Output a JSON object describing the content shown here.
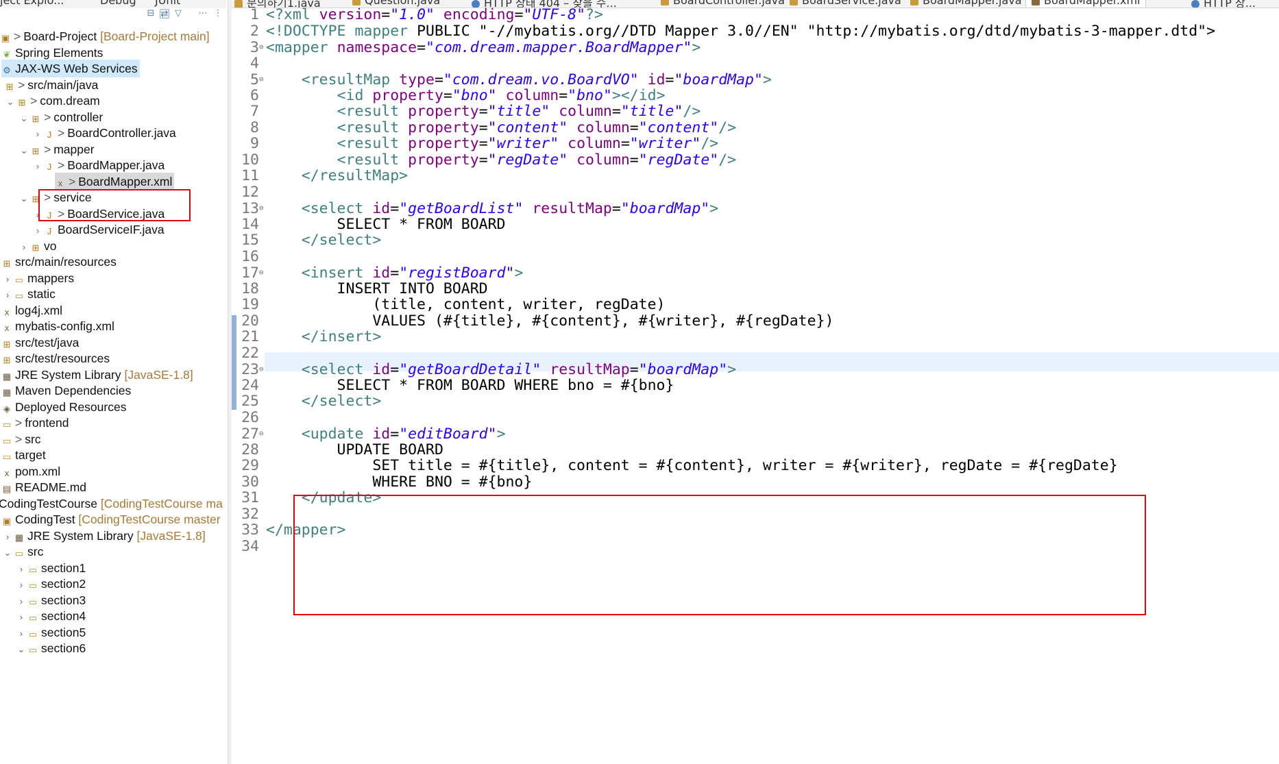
{
  "left_tabs": [
    "ject Explo...",
    "Debug",
    "JUnit"
  ],
  "left_toolbar_icons": [
    "collapse-all-icon",
    "link-with-editor-icon",
    "filter-icon",
    "view-menu-icon",
    "more-icon"
  ],
  "editor_tabs": [
    {
      "label": "문의하기1.java",
      "active": false
    },
    {
      "label": "Question.java",
      "active": false
    },
    {
      "label": "HTTP 상태 404 – 찾을 수...",
      "active": false
    },
    {
      "label": "BoardController.java",
      "active": false
    },
    {
      "label": "BoardService.java",
      "active": false
    },
    {
      "label": "BoardMapper.java",
      "active": false
    },
    {
      "label": "BoardMapper.xml",
      "active": true
    },
    {
      "label": "HTTP 상...",
      "active": false
    }
  ],
  "tree": [
    {
      "text": "Board-Project",
      "dim": "[Board-Project main]",
      "prefix": ">",
      "icon": "project-icon",
      "state": "none"
    },
    {
      "text": "Spring Elements",
      "icon": "spring-icon",
      "state": "none"
    },
    {
      "text": "JAX-WS Web Services",
      "icon": "webservice-icon",
      "state": "highlight"
    },
    {
      "text": "src/main/java",
      "prefix": ">",
      "icon": "source-folder-icon",
      "state": "none"
    },
    {
      "text": "com.dream",
      "prefix": ">",
      "icon": "package-icon",
      "chevron": "⌄",
      "state": "none"
    },
    {
      "text": "controller",
      "prefix": ">",
      "icon": "package-icon",
      "chevron": "⌄",
      "state": "none"
    },
    {
      "text": "BoardController.java",
      "prefix": ">",
      "icon": "java-file-icon",
      "chevron": "›",
      "state": "none"
    },
    {
      "text": "mapper",
      "prefix": ">",
      "icon": "package-icon",
      "chevron": "⌄",
      "state": "none"
    },
    {
      "text": "BoardMapper.java",
      "prefix": ">",
      "icon": "java-file-icon",
      "chevron": "›",
      "state": "none"
    },
    {
      "text": "BoardMapper.xml",
      "prefix": ">",
      "icon": "xml-file-icon",
      "state": "selected"
    },
    {
      "text": "service",
      "prefix": ">",
      "icon": "package-icon",
      "chevron": "⌄",
      "state": "none"
    },
    {
      "text": "BoardService.java",
      "prefix": ">",
      "icon": "java-file-icon",
      "chevron": "›",
      "state": "none"
    },
    {
      "text": "BoardServiceIF.java",
      "icon": "java-file-icon",
      "chevron": "›",
      "state": "none"
    },
    {
      "text": "vo",
      "icon": "package-icon",
      "chevron": "›",
      "state": "none"
    },
    {
      "text": "src/main/resources",
      "icon": "source-folder-icon",
      "state": "none"
    },
    {
      "text": "mappers",
      "icon": "folder-icon",
      "chevron": "›",
      "state": "none"
    },
    {
      "text": "static",
      "icon": "folder-icon",
      "chevron": "›",
      "state": "none"
    },
    {
      "text": "log4j.xml",
      "icon": "xml-file-icon",
      "state": "none"
    },
    {
      "text": "mybatis-config.xml",
      "icon": "xml-file-icon",
      "state": "none"
    },
    {
      "text": "src/test/java",
      "icon": "source-folder-icon",
      "state": "none"
    },
    {
      "text": "src/test/resources",
      "icon": "source-folder-icon",
      "state": "none"
    },
    {
      "text": "JRE System Library",
      "dim": "[JavaSE-1.8]",
      "icon": "library-icon",
      "state": "none"
    },
    {
      "text": "Maven Dependencies",
      "icon": "library-icon",
      "state": "none"
    },
    {
      "text": "Deployed Resources",
      "icon": "deployed-icon",
      "state": "none"
    },
    {
      "text": "frontend",
      "prefix": ">",
      "icon": "folder-icon",
      "state": "none"
    },
    {
      "text": "src",
      "prefix": ">",
      "icon": "folder-icon",
      "state": "none"
    },
    {
      "text": "target",
      "icon": "folder-icon",
      "state": "none"
    },
    {
      "text": "pom.xml",
      "icon": "xml-file-icon",
      "state": "none"
    },
    {
      "text": "README.md",
      "icon": "file-icon",
      "state": "none"
    },
    {
      "text": "CodingTestCourse",
      "dim": "[CodingTestCourse ma",
      "icon": "none",
      "state": "none"
    },
    {
      "text": "CodingTest",
      "dim": "[CodingTestCourse master",
      "icon": "project-icon",
      "state": "none"
    },
    {
      "text": "JRE System Library",
      "dim": "[JavaSE-1.8]",
      "icon": "library-icon",
      "chevron": "›",
      "state": "none"
    },
    {
      "text": "src",
      "icon": "folder-icon",
      "chevron": "⌄",
      "state": "none"
    },
    {
      "text": "section1",
      "icon": "folder-icon",
      "chevron": "›",
      "state": "none"
    },
    {
      "text": "section2",
      "icon": "folder-icon",
      "chevron": "›",
      "state": "none"
    },
    {
      "text": "section3",
      "icon": "folder-icon",
      "chevron": "›",
      "state": "none"
    },
    {
      "text": "section4",
      "icon": "folder-icon",
      "chevron": "›",
      "state": "none"
    },
    {
      "text": "section5",
      "icon": "folder-icon",
      "chevron": "›",
      "state": "none"
    },
    {
      "text": "section6",
      "icon": "folder-icon",
      "chevron": "⌄",
      "state": "none"
    }
  ],
  "code": [
    {
      "n": "1",
      "fold": false,
      "parts": [
        [
          "pi",
          "<?xml "
        ],
        [
          "attr",
          "version"
        ],
        [
          "txt",
          "="
        ],
        [
          "val",
          "\"1.0\""
        ],
        [
          "txt",
          " "
        ],
        [
          "attr",
          "encoding"
        ],
        [
          "txt",
          "="
        ],
        [
          "val",
          "\"UTF-8\""
        ],
        [
          "pi",
          "?>"
        ]
      ]
    },
    {
      "n": "2",
      "fold": false,
      "parts": [
        [
          "tag",
          "<!DOCTYPE "
        ],
        [
          "tag",
          "mapper"
        ],
        [
          "txt",
          " PUBLIC \"-//mybatis.org//DTD Mapper 3.0//EN\" \"http://mybatis.org/dtd/mybatis-3-mapper.dtd\">"
        ]
      ]
    },
    {
      "n": "3",
      "fold": true,
      "parts": [
        [
          "tag",
          "<mapper "
        ],
        [
          "attr",
          "namespace"
        ],
        [
          "txt",
          "="
        ],
        [
          "val",
          "\"com.dream.mapper.BoardMapper\""
        ],
        [
          "tag",
          ">"
        ]
      ]
    },
    {
      "n": "4",
      "fold": false,
      "parts": []
    },
    {
      "n": "5",
      "fold": true,
      "parts": [
        [
          "txt",
          "    "
        ],
        [
          "tag",
          "<resultMap "
        ],
        [
          "attr",
          "type"
        ],
        [
          "txt",
          "="
        ],
        [
          "val",
          "\"com.dream.vo.BoardVO\""
        ],
        [
          "txt",
          " "
        ],
        [
          "attr",
          "id"
        ],
        [
          "txt",
          "="
        ],
        [
          "val",
          "\"boardMap\""
        ],
        [
          "tag",
          ">"
        ]
      ]
    },
    {
      "n": "6",
      "fold": false,
      "parts": [
        [
          "txt",
          "        "
        ],
        [
          "tag",
          "<id "
        ],
        [
          "attr",
          "property"
        ],
        [
          "txt",
          "="
        ],
        [
          "val",
          "\"bno\""
        ],
        [
          "txt",
          " "
        ],
        [
          "attr",
          "column"
        ],
        [
          "txt",
          "="
        ],
        [
          "val",
          "\"bno\""
        ],
        [
          "tag",
          "></id>"
        ]
      ]
    },
    {
      "n": "7",
      "fold": false,
      "parts": [
        [
          "txt",
          "        "
        ],
        [
          "tag",
          "<result "
        ],
        [
          "attr",
          "property"
        ],
        [
          "txt",
          "="
        ],
        [
          "val",
          "\"title\""
        ],
        [
          "txt",
          " "
        ],
        [
          "attr",
          "column"
        ],
        [
          "txt",
          "="
        ],
        [
          "val",
          "\"title\""
        ],
        [
          "tag",
          "/>"
        ]
      ]
    },
    {
      "n": "8",
      "fold": false,
      "parts": [
        [
          "txt",
          "        "
        ],
        [
          "tag",
          "<result "
        ],
        [
          "attr",
          "property"
        ],
        [
          "txt",
          "="
        ],
        [
          "val",
          "\"content\""
        ],
        [
          "txt",
          " "
        ],
        [
          "attr",
          "column"
        ],
        [
          "txt",
          "="
        ],
        [
          "val",
          "\"content\""
        ],
        [
          "tag",
          "/>"
        ]
      ]
    },
    {
      "n": "9",
      "fold": false,
      "parts": [
        [
          "txt",
          "        "
        ],
        [
          "tag",
          "<result "
        ],
        [
          "attr",
          "property"
        ],
        [
          "txt",
          "="
        ],
        [
          "val",
          "\"writer\""
        ],
        [
          "txt",
          " "
        ],
        [
          "attr",
          "column"
        ],
        [
          "txt",
          "="
        ],
        [
          "val",
          "\"writer\""
        ],
        [
          "tag",
          "/>"
        ]
      ]
    },
    {
      "n": "10",
      "fold": false,
      "parts": [
        [
          "txt",
          "        "
        ],
        [
          "tag",
          "<result "
        ],
        [
          "attr",
          "property"
        ],
        [
          "txt",
          "="
        ],
        [
          "val",
          "\"regDate\""
        ],
        [
          "txt",
          " "
        ],
        [
          "attr",
          "column"
        ],
        [
          "txt",
          "="
        ],
        [
          "val",
          "\"regDate\""
        ],
        [
          "tag",
          "/>"
        ]
      ]
    },
    {
      "n": "11",
      "fold": false,
      "parts": [
        [
          "txt",
          "    "
        ],
        [
          "tag",
          "</resultMap>"
        ]
      ]
    },
    {
      "n": "12",
      "fold": false,
      "parts": []
    },
    {
      "n": "13",
      "fold": true,
      "parts": [
        [
          "txt",
          "    "
        ],
        [
          "tag",
          "<select "
        ],
        [
          "attr",
          "id"
        ],
        [
          "txt",
          "="
        ],
        [
          "val",
          "\"getBoardList\""
        ],
        [
          "txt",
          " "
        ],
        [
          "attr",
          "resultMap"
        ],
        [
          "txt",
          "="
        ],
        [
          "val",
          "\"boardMap\""
        ],
        [
          "tag",
          ">"
        ]
      ]
    },
    {
      "n": "14",
      "fold": false,
      "parts": [
        [
          "txt",
          "        SELECT * FROM BOARD"
        ]
      ]
    },
    {
      "n": "15",
      "fold": false,
      "parts": [
        [
          "txt",
          "    "
        ],
        [
          "tag",
          "</select>"
        ]
      ]
    },
    {
      "n": "16",
      "fold": false,
      "parts": []
    },
    {
      "n": "17",
      "fold": true,
      "parts": [
        [
          "txt",
          "    "
        ],
        [
          "tag",
          "<insert "
        ],
        [
          "attr",
          "id"
        ],
        [
          "txt",
          "="
        ],
        [
          "val",
          "\"registBoard\""
        ],
        [
          "tag",
          ">"
        ]
      ]
    },
    {
      "n": "18",
      "fold": false,
      "parts": [
        [
          "txt",
          "        INSERT INTO BOARD"
        ]
      ]
    },
    {
      "n": "19",
      "fold": false,
      "parts": [
        [
          "txt",
          "            (title, content, writer, regDate)"
        ]
      ]
    },
    {
      "n": "20",
      "fold": false,
      "parts": [
        [
          "txt",
          "            VALUES (#{title}, #{content}, #{writer}, #{regDate})"
        ]
      ]
    },
    {
      "n": "21",
      "fold": false,
      "parts": [
        [
          "txt",
          "    "
        ],
        [
          "tag",
          "</insert>"
        ]
      ]
    },
    {
      "n": "22",
      "fold": false,
      "parts": []
    },
    {
      "n": "23",
      "fold": true,
      "parts": [
        [
          "txt",
          "    "
        ],
        [
          "tag",
          "<select "
        ],
        [
          "attr",
          "id"
        ],
        [
          "txt",
          "="
        ],
        [
          "val",
          "\"getBoardDetail\""
        ],
        [
          "txt",
          " "
        ],
        [
          "attr",
          "resultMap"
        ],
        [
          "txt",
          "="
        ],
        [
          "val",
          "\"boardMap\""
        ],
        [
          "tag",
          ">"
        ]
      ]
    },
    {
      "n": "24",
      "fold": false,
      "parts": [
        [
          "txt",
          "        SELECT * FROM BOARD WHERE bno = #{bno}"
        ]
      ]
    },
    {
      "n": "25",
      "fold": false,
      "parts": [
        [
          "txt",
          "    "
        ],
        [
          "tag",
          "</select>"
        ]
      ]
    },
    {
      "n": "26",
      "fold": false,
      "parts": []
    },
    {
      "n": "27",
      "fold": true,
      "parts": [
        [
          "txt",
          "    "
        ],
        [
          "tag",
          "<update "
        ],
        [
          "attr",
          "id"
        ],
        [
          "txt",
          "="
        ],
        [
          "val",
          "\"editBoard\""
        ],
        [
          "tag",
          ">"
        ]
      ]
    },
    {
      "n": "28",
      "fold": false,
      "parts": [
        [
          "txt",
          "        UPDATE BOARD"
        ]
      ]
    },
    {
      "n": "29",
      "fold": false,
      "parts": [
        [
          "txt",
          "            SET title = #{title}, content = #{content}, writer = #{writer}, regDate = #{regDate}"
        ]
      ]
    },
    {
      "n": "30",
      "fold": false,
      "parts": [
        [
          "txt",
          "            WHERE BNO = #{bno}"
        ]
      ]
    },
    {
      "n": "31",
      "fold": false,
      "parts": [
        [
          "txt",
          "    "
        ],
        [
          "tag",
          "</update>"
        ]
      ]
    },
    {
      "n": "32",
      "fold": false,
      "parts": []
    },
    {
      "n": "33",
      "fold": false,
      "parts": [
        [
          "tag",
          "</mapper>"
        ]
      ]
    },
    {
      "n": "34",
      "fold": false,
      "parts": []
    }
  ],
  "current_line": "19",
  "colors": {
    "highlight_box": "#e8000b",
    "tag": "#3f7f7f",
    "attr": "#7f007f",
    "value": "#2a00ff",
    "selection": "#cfe8fc"
  }
}
